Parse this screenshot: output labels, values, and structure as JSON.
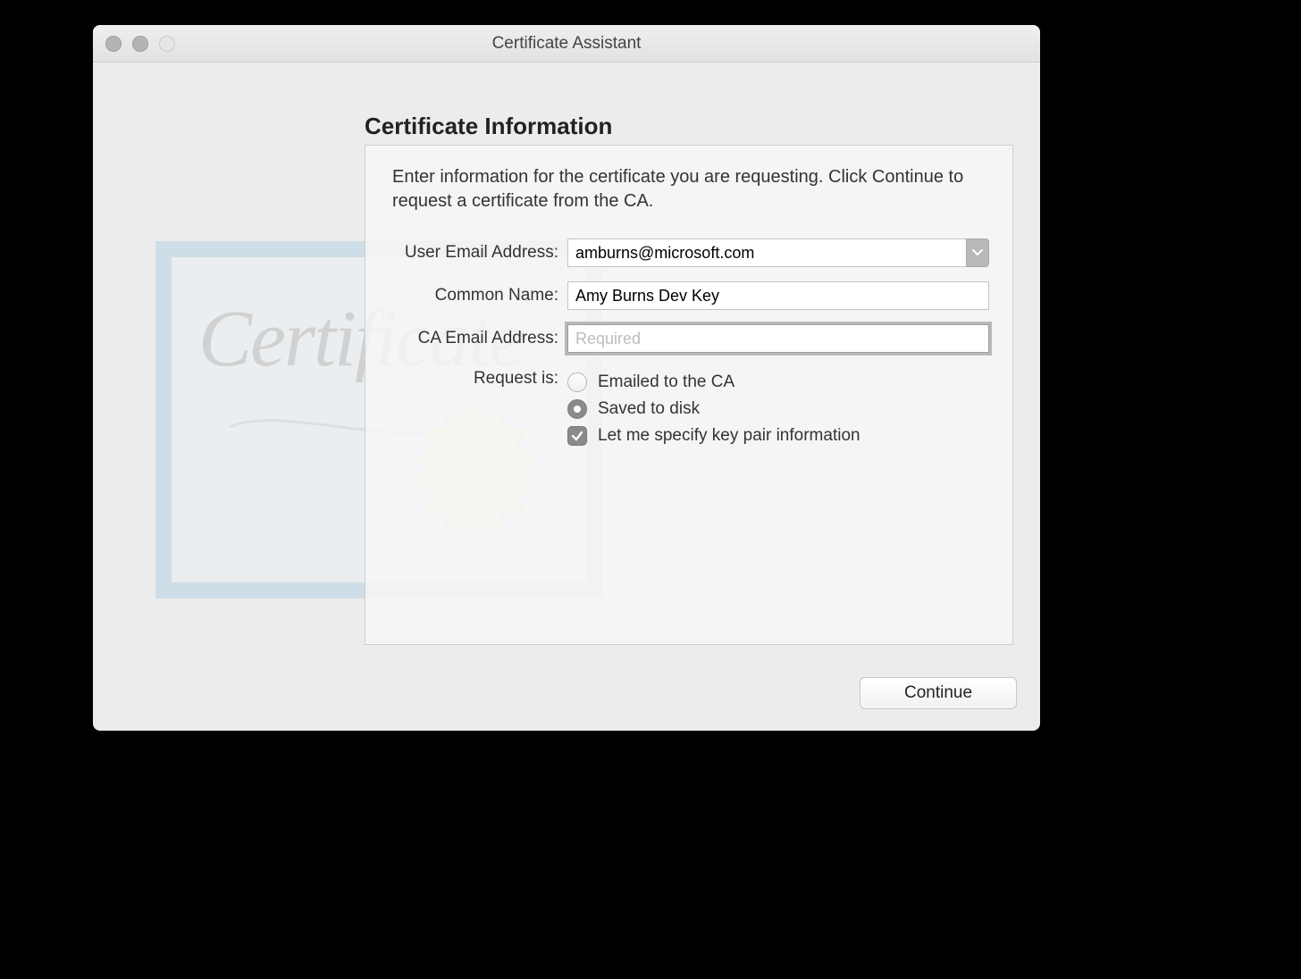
{
  "window": {
    "title": "Certificate Assistant"
  },
  "page": {
    "heading": "Certificate Information",
    "instructions": "Enter information for the certificate you are requesting. Click Continue to request a certificate from the CA."
  },
  "form": {
    "user_email": {
      "label": "User Email Address:",
      "value": "amburns@microsoft.com"
    },
    "common_name": {
      "label": "Common Name:",
      "value": "Amy Burns Dev Key"
    },
    "ca_email": {
      "label": "CA Email Address:",
      "value": "",
      "placeholder": "Required"
    },
    "request_is": {
      "label": "Request is:",
      "options": {
        "emailed": "Emailed to the CA",
        "saved": "Saved to disk"
      },
      "selected": "saved"
    },
    "specify_keypair": {
      "label": "Let me specify key pair information",
      "checked": true
    }
  },
  "buttons": {
    "continue": "Continue"
  }
}
